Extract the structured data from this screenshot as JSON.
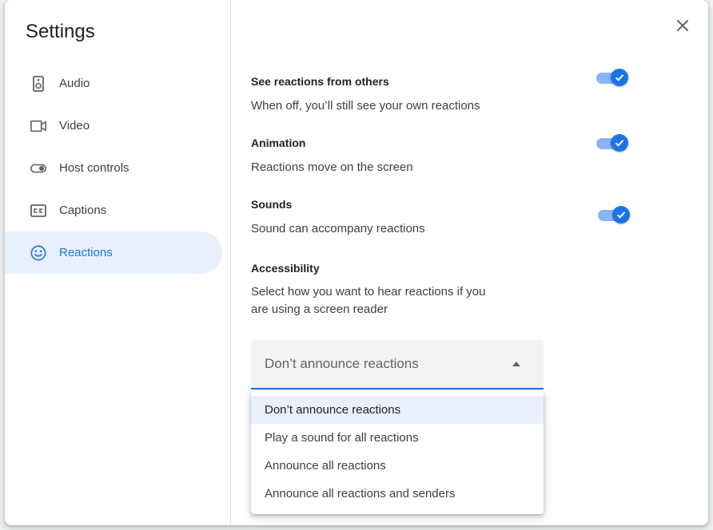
{
  "dialog": {
    "title": "Settings",
    "close_icon": "close-icon"
  },
  "sidebar": {
    "items": [
      {
        "label": "Audio",
        "icon": "speaker-icon",
        "active": false
      },
      {
        "label": "Video",
        "icon": "video-camera-icon",
        "active": false
      },
      {
        "label": "Host controls",
        "icon": "toggle-icon",
        "active": false
      },
      {
        "label": "Captions",
        "icon": "captions-icon",
        "active": false
      },
      {
        "label": "Reactions",
        "icon": "smiley-icon",
        "active": true
      }
    ]
  },
  "settings": {
    "see_reactions": {
      "title": "See reactions from others",
      "desc": "When off, you’ll still see your own reactions",
      "enabled": true
    },
    "animation": {
      "title": "Animation",
      "desc": "Reactions move on the screen",
      "enabled": true
    },
    "sounds": {
      "title": "Sounds",
      "desc": "Sound can accompany reactions",
      "enabled": true
    },
    "accessibility": {
      "title": "Accessibility",
      "desc_line1": "Select how you want to hear reactions if you",
      "desc_line2": "are using a screen reader",
      "selected": "Don’t announce reactions",
      "options": [
        "Don’t announce reactions",
        "Play a sound for all reactions",
        "Announce all reactions",
        "Announce all reactions and senders"
      ]
    }
  },
  "colors": {
    "accent": "#1a73e8",
    "active_bg": "#e8f0fe",
    "toggle_track": "#8ab4f8"
  }
}
